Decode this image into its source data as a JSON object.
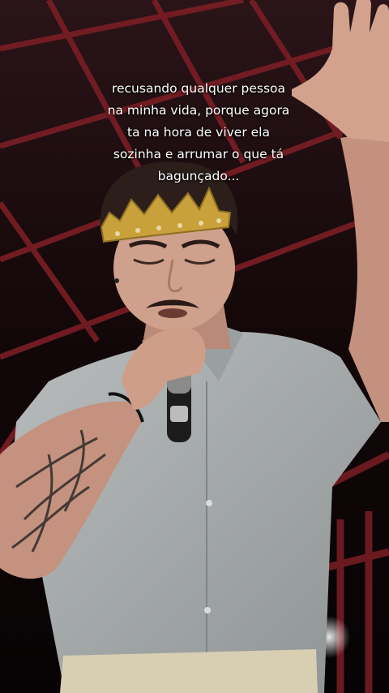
{
  "caption": {
    "lines": [
      "recusando qualquer pessoa",
      "na minha vida, porque agora",
      "ta na hora de viver ela",
      "sozinha e arrumar o que tá",
      "bagunçado..."
    ]
  },
  "colors": {
    "background": "#0d0608",
    "truss_red": "#7a1e24",
    "shirt": "#a9adae",
    "skin": "#c99a86",
    "crown": "#c9a13a",
    "text": "#ffffff"
  }
}
